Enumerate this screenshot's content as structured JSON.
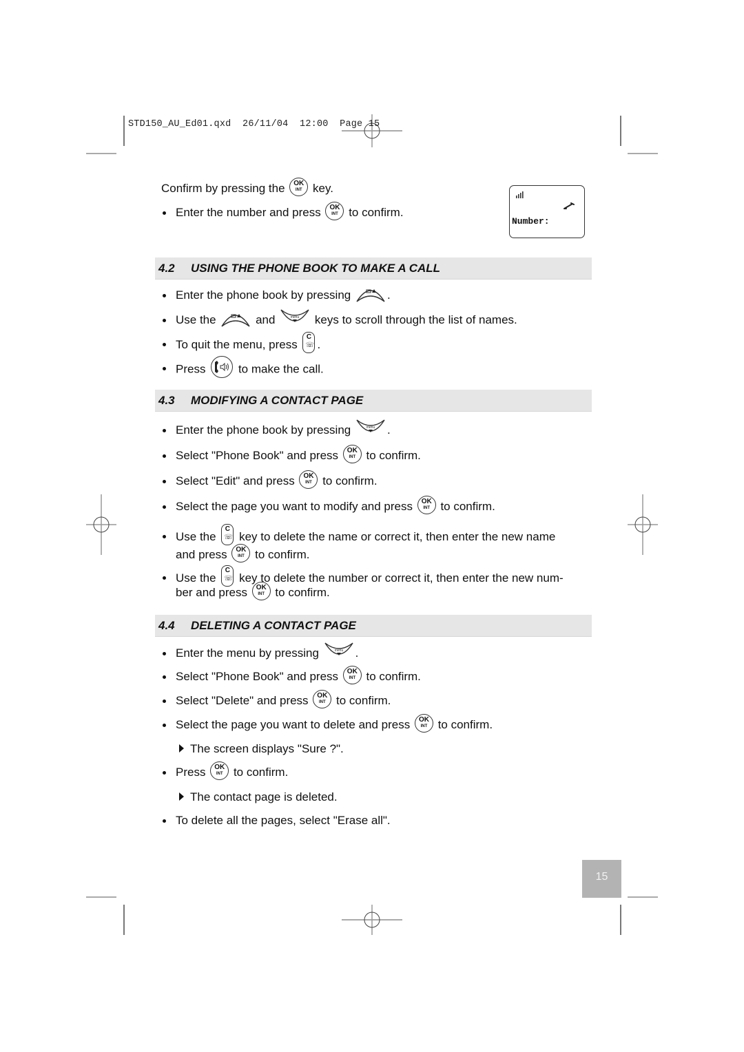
{
  "slug": "STD150_AU_Ed01.qxd  26/11/04  12:00  Page 15",
  "intro": {
    "confirm_line": [
      "Confirm by pressing the",
      "key."
    ],
    "enter_number": [
      "Enter the number and press",
      "to confirm."
    ]
  },
  "lcd": {
    "signal_icon": "signal-bars-icon",
    "handset_icon": "handset-icon",
    "label": "Number:"
  },
  "sections": [
    {
      "number": "4.2",
      "title": "USING THE PHONE BOOK TO MAKE A CALL",
      "items": [
        [
          "Enter the phone book by pressing",
          "."
        ],
        [
          "Use the",
          "and",
          "keys to scroll through the list of names."
        ],
        [
          "To quit the menu, press",
          "."
        ],
        [
          "Press",
          "to make the call."
        ]
      ]
    },
    {
      "number": "4.3",
      "title": "MODIFYING A CONTACT PAGE",
      "items": [
        [
          "Enter the phone book by pressing",
          "."
        ],
        [
          "Select \"Phone Book\" and press",
          "to confirm."
        ],
        [
          "Select \"Edit\" and press",
          "to confirm."
        ],
        [
          "Select the page you want to modify and press",
          "to confirm."
        ],
        [
          "Use the",
          "key to delete the name or correct it, then enter the new name",
          "and press",
          "to confirm."
        ],
        [
          "Use the",
          "key to delete the number or correct it, then enter the new num-",
          "ber and press",
          "to confirm."
        ]
      ]
    },
    {
      "number": "4.4",
      "title": "DELETING A CONTACT PAGE",
      "items": [
        [
          "Enter the menu by pressing",
          "."
        ],
        [
          "Select \"Phone Book\" and press",
          "to confirm."
        ],
        [
          "Select \"Delete\" and press",
          "to confirm."
        ],
        [
          "Select the page you want to delete and press",
          "to confirm."
        ],
        [
          "The screen displays \"Sure ?\"."
        ],
        [
          "Press",
          "to confirm."
        ],
        [
          "The contact page is deleted."
        ],
        [
          "To delete all the pages, select \"Erase all\"."
        ]
      ]
    }
  ],
  "keys": {
    "ok_top": "OK",
    "ok_bottom": "INT",
    "c_label": "C",
    "menu_label": "menu"
  },
  "page_number": "15"
}
